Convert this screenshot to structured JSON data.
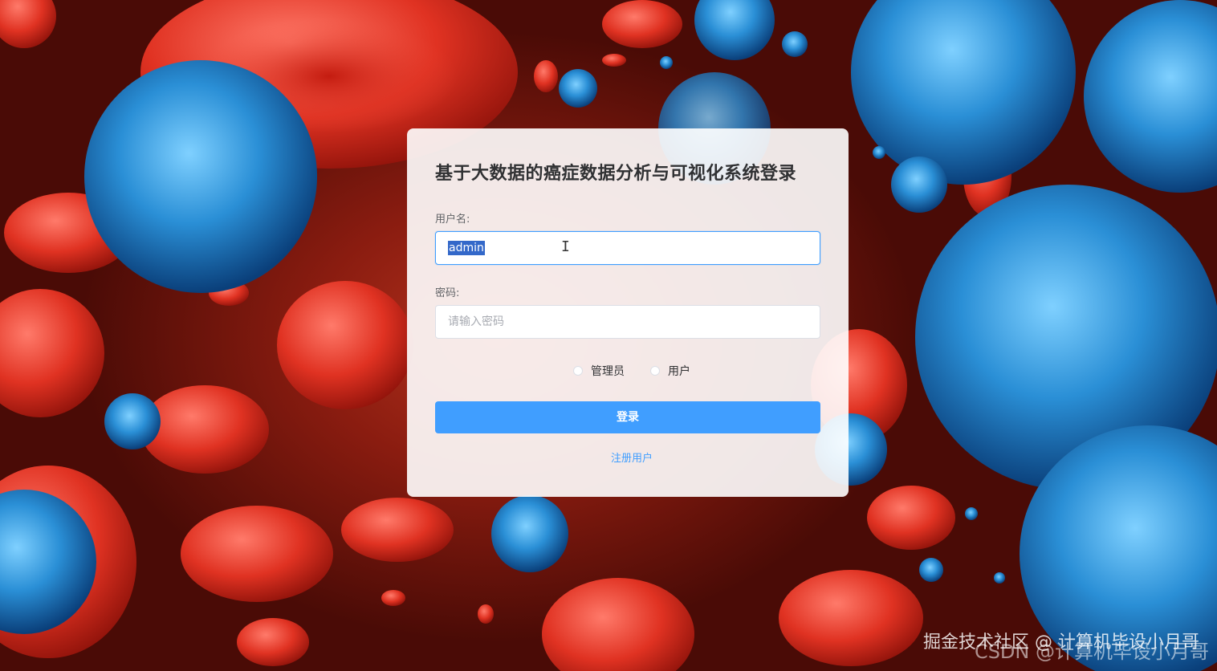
{
  "login": {
    "title": "基于大数据的癌症数据分析与可视化系统登录",
    "username_label": "用户名:",
    "username_value": "admin",
    "password_label": "密码:",
    "password_placeholder": "请输入密码",
    "roles": [
      {
        "label": "管理员",
        "selected": false
      },
      {
        "label": "用户",
        "selected": false
      }
    ],
    "login_button": "登录",
    "register_link": "注册用户"
  },
  "watermark": {
    "primary": "掘金技术社区 @ 计算机毕设小月哥",
    "secondary": "CSDN @计算机毕设小月哥"
  },
  "colors": {
    "accent": "#409eff",
    "selection": "#3368c9",
    "card_bg": "#ffffff"
  }
}
